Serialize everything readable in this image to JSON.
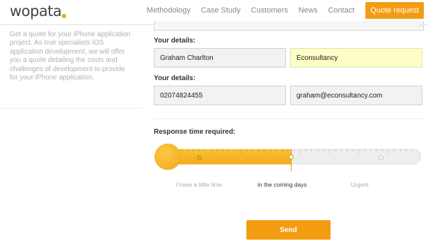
{
  "brand": {
    "logo_text": "wopata",
    "accent_color": "#f39c12"
  },
  "nav": {
    "items": [
      "Methodology",
      "Case Study",
      "Customers",
      "News",
      "Contact"
    ],
    "cta_label": "Quote request"
  },
  "intro_text": "Get a quote for your iPhone application project. As true specialists iOS application development, we will offer you a quote detailing the costs and challenges of development to provide for your iPhone application.",
  "form": {
    "details_label_1": "Your details:",
    "name_value": "Graham Charlton",
    "company_value": "Econsultancy",
    "details_label_2": "Your details:",
    "phone_value": "02074824455",
    "email_value": "graham@econsultancy.com",
    "response_label": "Response time required:",
    "response_options": [
      "I have a little time",
      "in the coming days",
      "Urgent"
    ],
    "response_selected": "in the coming days",
    "response_level": 0.5,
    "send_label": "Send"
  },
  "icons": {
    "resize": "resize-grip-icon"
  }
}
